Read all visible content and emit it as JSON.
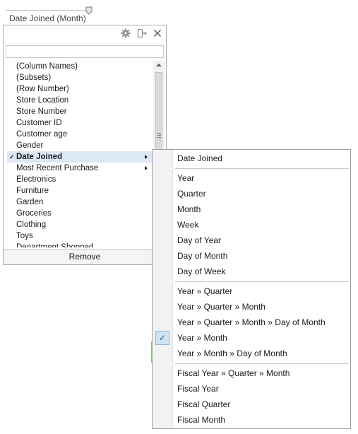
{
  "slider": {
    "label": "Date Joined (Month)"
  },
  "panel": {
    "search": {
      "value": "",
      "placeholder": ""
    },
    "items": [
      {
        "label": "(Column Names)"
      },
      {
        "label": "(Subsets)"
      },
      {
        "label": "(Row Number)"
      },
      {
        "label": "Store Location"
      },
      {
        "label": "Store Number"
      },
      {
        "label": "Customer ID"
      },
      {
        "label": "Customer age"
      },
      {
        "label": "Gender"
      },
      {
        "label": "Date Joined",
        "selected": true,
        "has_submenu": true
      },
      {
        "label": "Most Recent Purchase",
        "has_submenu": true
      },
      {
        "label": "Electronics"
      },
      {
        "label": "Furniture"
      },
      {
        "label": "Garden"
      },
      {
        "label": "Groceries"
      },
      {
        "label": "Clothing"
      },
      {
        "label": "Toys"
      },
      {
        "label": "Department Shopped"
      }
    ],
    "remove_label": "Remove",
    "check_mark": "✓"
  },
  "submenu": {
    "check_mark": "✓",
    "items": [
      {
        "label": "Date Joined"
      },
      {
        "label": "Year"
      },
      {
        "label": "Quarter"
      },
      {
        "label": "Month"
      },
      {
        "label": "Week"
      },
      {
        "label": "Day of Year"
      },
      {
        "label": "Day of Month"
      },
      {
        "label": "Day of Week"
      },
      {
        "label": "Year » Quarter"
      },
      {
        "label": "Year » Quarter » Month"
      },
      {
        "label": "Year » Quarter » Month » Day of Month"
      },
      {
        "label": "Year » Month",
        "checked": true
      },
      {
        "label": "Year » Month » Day of Month"
      },
      {
        "label": "Fiscal Year » Quarter » Month"
      },
      {
        "label": "Fiscal Year"
      },
      {
        "label": "Fiscal Quarter"
      },
      {
        "label": "Fiscal Month"
      }
    ]
  },
  "colors": {
    "selection": "#dce8f5",
    "check_bg": "#cfe3f7",
    "border": "#a9a9a9"
  },
  "icons": {
    "settings": "gear-icon",
    "popout": "pop-out-icon",
    "close": "close-icon"
  }
}
